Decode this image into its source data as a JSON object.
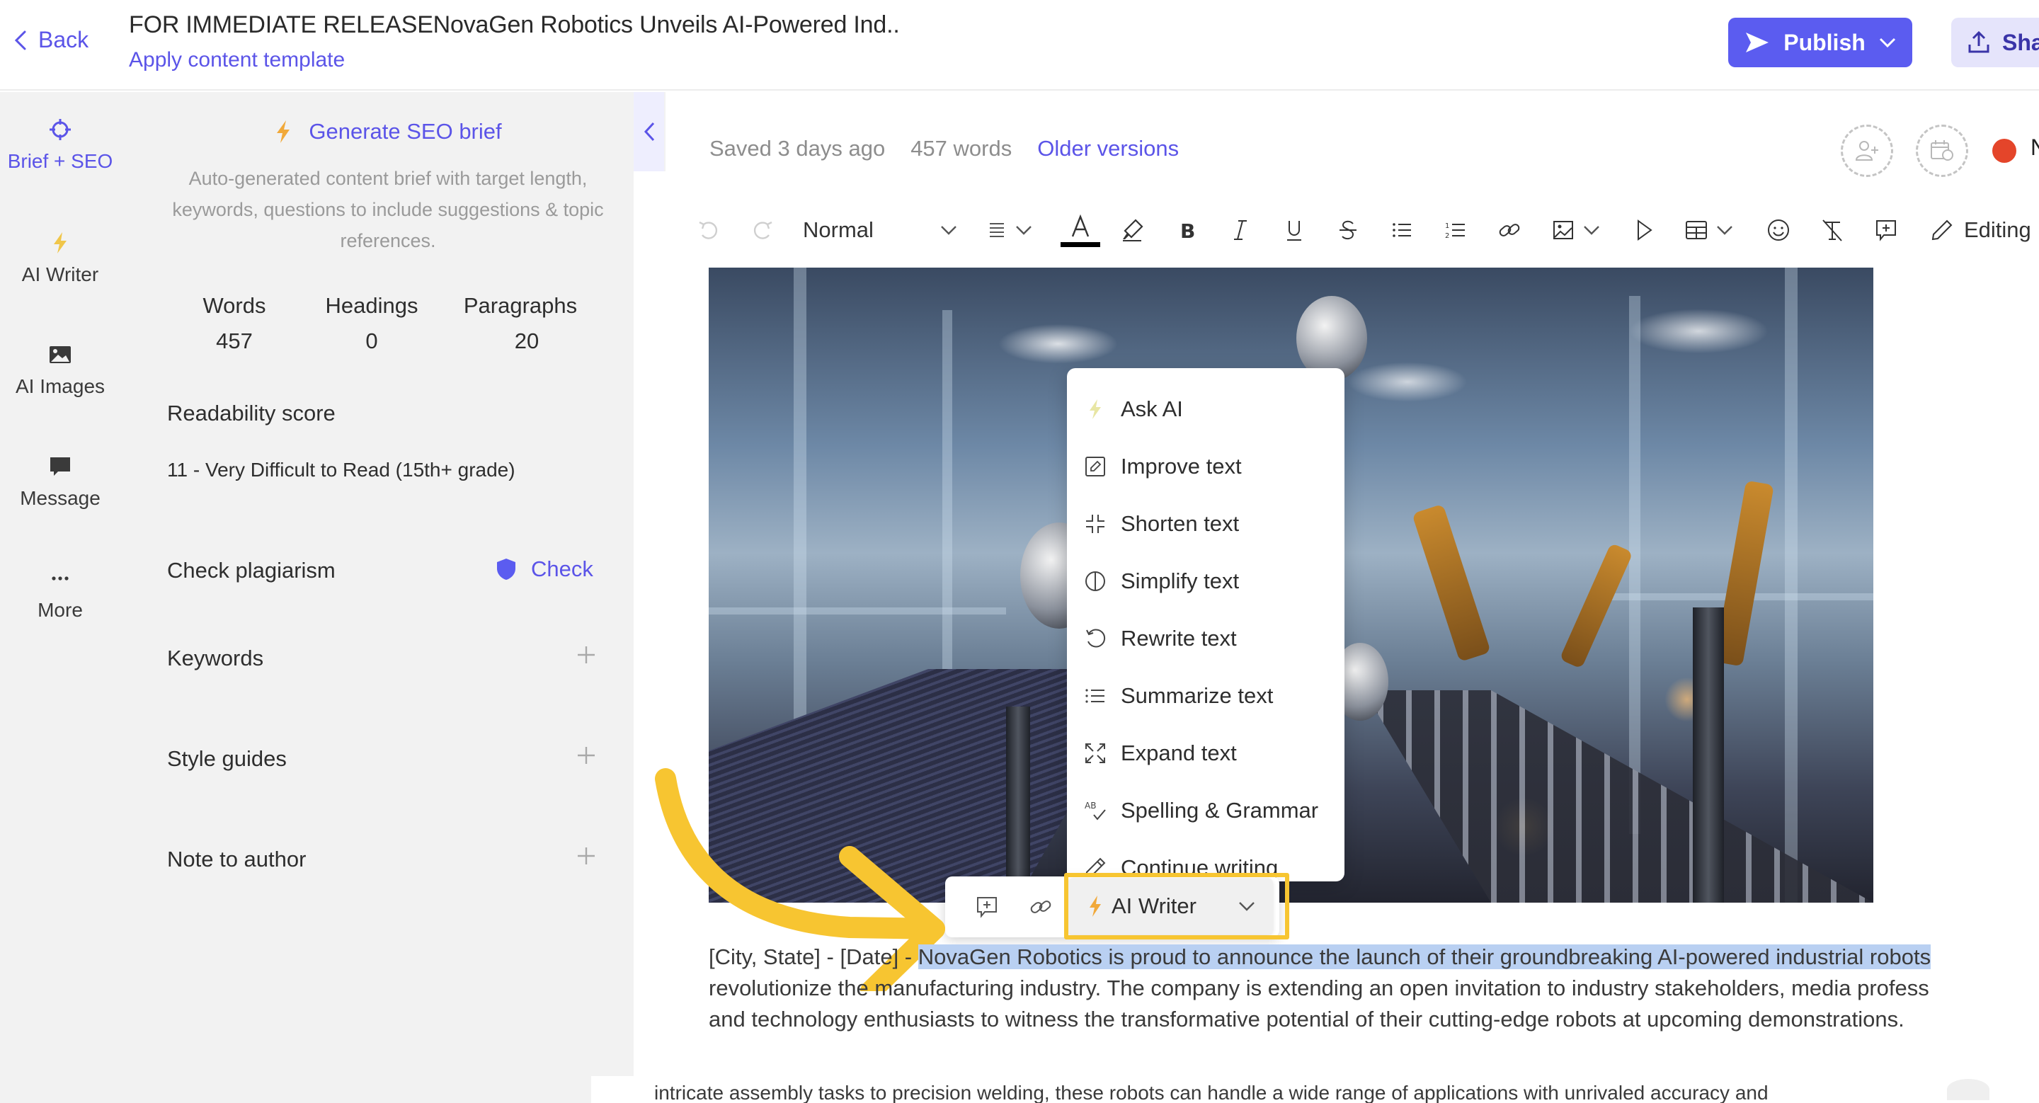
{
  "header": {
    "back_label": "Back",
    "title": "FOR IMMEDIATE RELEASENovaGen Robotics Unveils AI-Powered Ind..",
    "apply_template_label": "Apply content template",
    "publish_label": "Publish",
    "share_label": "Sha"
  },
  "rail": {
    "items": [
      {
        "label": "Brief + SEO",
        "icon": "target-icon",
        "active": true
      },
      {
        "label": "AI Writer",
        "icon": "bolt-icon",
        "active": false
      },
      {
        "label": "AI Images",
        "icon": "image-icon",
        "active": false
      },
      {
        "label": "Message",
        "icon": "chat-bubble-icon",
        "active": false
      },
      {
        "label": "More",
        "icon": "ellipsis-icon",
        "active": false
      }
    ]
  },
  "brief": {
    "generate_label": "Generate SEO brief",
    "description": "Auto-generated content brief with target length, keywords, questions to include suggestions & topic references.",
    "stats": [
      {
        "label": "Words",
        "value": "457"
      },
      {
        "label": "Headings",
        "value": "0"
      },
      {
        "label": "Paragraphs",
        "value": "20"
      }
    ],
    "readability_title": "Readability score",
    "readability_value": "11 - Very Difficult to Read (15th+ grade)",
    "plagiarism_title": "Check plagiarism",
    "plagiarism_action": "Check",
    "sections": [
      {
        "label": "Keywords"
      },
      {
        "label": "Style guides"
      },
      {
        "label": "Note to author"
      }
    ]
  },
  "editor": {
    "saved_status": "Saved 3 days ago",
    "word_count": "457 words",
    "older_versions_label": "Older versions",
    "status_letter": "N",
    "status_color": "#e4452a",
    "toolbar": {
      "style_value": "Normal",
      "mode_label": "Editing"
    }
  },
  "ai_menu": {
    "items": [
      {
        "label": "Ask AI",
        "icon": "bolt-icon"
      },
      {
        "label": "Improve text",
        "icon": "edit-box-icon"
      },
      {
        "label": "Shorten text",
        "icon": "shrink-icon"
      },
      {
        "label": "Simplify text",
        "icon": "half-circle-icon"
      },
      {
        "label": "Rewrite text",
        "icon": "rotate-icon"
      },
      {
        "label": "Summarize text",
        "icon": "list-icon"
      },
      {
        "label": "Expand text",
        "icon": "expand-icon"
      },
      {
        "label": "Spelling & Grammar",
        "icon": "spellcheck-icon"
      },
      {
        "label": "Continue writing",
        "icon": "pencil-icon"
      }
    ]
  },
  "bubble": {
    "ai_writer_label": "AI Writer"
  },
  "content": {
    "para_prefix": "[City, State] - [Date] - ",
    "para_selected": "NovaGen Robotics is proud to announce the launch of their groundbreaking AI-powered industrial robots",
    "para_line2": "revolutionize the manufacturing industry. The company is extending an open invitation to industry stakeholders, media profess",
    "para_line3": "and technology enthusiasts to witness the transformative potential of their cutting-edge robots at upcoming demonstrations.",
    "next_para": "intricate assembly tasks to precision welding, these robots can handle a wide range of applications with unrivaled accuracy and"
  },
  "colors": {
    "accent": "#5b54e8",
    "publish_bg": "#5b5cf0",
    "highlight": "#f7c531",
    "selection": "#b9d0f2",
    "panel_bg": "#f2f2f2"
  }
}
